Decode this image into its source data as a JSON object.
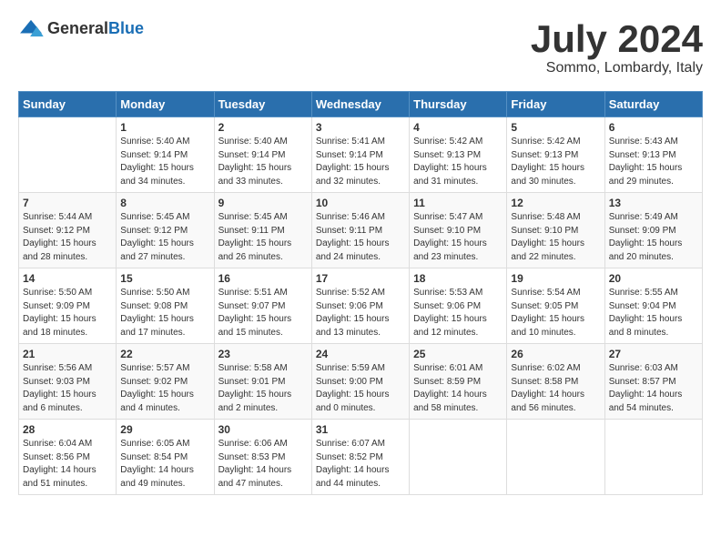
{
  "logo": {
    "general": "General",
    "blue": "Blue"
  },
  "title": "July 2024",
  "location": "Sommo, Lombardy, Italy",
  "weekdays": [
    "Sunday",
    "Monday",
    "Tuesday",
    "Wednesday",
    "Thursday",
    "Friday",
    "Saturday"
  ],
  "weeks": [
    [
      {
        "day": "",
        "info": ""
      },
      {
        "day": "1",
        "info": "Sunrise: 5:40 AM\nSunset: 9:14 PM\nDaylight: 15 hours\nand 34 minutes."
      },
      {
        "day": "2",
        "info": "Sunrise: 5:40 AM\nSunset: 9:14 PM\nDaylight: 15 hours\nand 33 minutes."
      },
      {
        "day": "3",
        "info": "Sunrise: 5:41 AM\nSunset: 9:14 PM\nDaylight: 15 hours\nand 32 minutes."
      },
      {
        "day": "4",
        "info": "Sunrise: 5:42 AM\nSunset: 9:13 PM\nDaylight: 15 hours\nand 31 minutes."
      },
      {
        "day": "5",
        "info": "Sunrise: 5:42 AM\nSunset: 9:13 PM\nDaylight: 15 hours\nand 30 minutes."
      },
      {
        "day": "6",
        "info": "Sunrise: 5:43 AM\nSunset: 9:13 PM\nDaylight: 15 hours\nand 29 minutes."
      }
    ],
    [
      {
        "day": "7",
        "info": "Sunrise: 5:44 AM\nSunset: 9:12 PM\nDaylight: 15 hours\nand 28 minutes."
      },
      {
        "day": "8",
        "info": "Sunrise: 5:45 AM\nSunset: 9:12 PM\nDaylight: 15 hours\nand 27 minutes."
      },
      {
        "day": "9",
        "info": "Sunrise: 5:45 AM\nSunset: 9:11 PM\nDaylight: 15 hours\nand 26 minutes."
      },
      {
        "day": "10",
        "info": "Sunrise: 5:46 AM\nSunset: 9:11 PM\nDaylight: 15 hours\nand 24 minutes."
      },
      {
        "day": "11",
        "info": "Sunrise: 5:47 AM\nSunset: 9:10 PM\nDaylight: 15 hours\nand 23 minutes."
      },
      {
        "day": "12",
        "info": "Sunrise: 5:48 AM\nSunset: 9:10 PM\nDaylight: 15 hours\nand 22 minutes."
      },
      {
        "day": "13",
        "info": "Sunrise: 5:49 AM\nSunset: 9:09 PM\nDaylight: 15 hours\nand 20 minutes."
      }
    ],
    [
      {
        "day": "14",
        "info": "Sunrise: 5:50 AM\nSunset: 9:09 PM\nDaylight: 15 hours\nand 18 minutes."
      },
      {
        "day": "15",
        "info": "Sunrise: 5:50 AM\nSunset: 9:08 PM\nDaylight: 15 hours\nand 17 minutes."
      },
      {
        "day": "16",
        "info": "Sunrise: 5:51 AM\nSunset: 9:07 PM\nDaylight: 15 hours\nand 15 minutes."
      },
      {
        "day": "17",
        "info": "Sunrise: 5:52 AM\nSunset: 9:06 PM\nDaylight: 15 hours\nand 13 minutes."
      },
      {
        "day": "18",
        "info": "Sunrise: 5:53 AM\nSunset: 9:06 PM\nDaylight: 15 hours\nand 12 minutes."
      },
      {
        "day": "19",
        "info": "Sunrise: 5:54 AM\nSunset: 9:05 PM\nDaylight: 15 hours\nand 10 minutes."
      },
      {
        "day": "20",
        "info": "Sunrise: 5:55 AM\nSunset: 9:04 PM\nDaylight: 15 hours\nand 8 minutes."
      }
    ],
    [
      {
        "day": "21",
        "info": "Sunrise: 5:56 AM\nSunset: 9:03 PM\nDaylight: 15 hours\nand 6 minutes."
      },
      {
        "day": "22",
        "info": "Sunrise: 5:57 AM\nSunset: 9:02 PM\nDaylight: 15 hours\nand 4 minutes."
      },
      {
        "day": "23",
        "info": "Sunrise: 5:58 AM\nSunset: 9:01 PM\nDaylight: 15 hours\nand 2 minutes."
      },
      {
        "day": "24",
        "info": "Sunrise: 5:59 AM\nSunset: 9:00 PM\nDaylight: 15 hours\nand 0 minutes."
      },
      {
        "day": "25",
        "info": "Sunrise: 6:01 AM\nSunset: 8:59 PM\nDaylight: 14 hours\nand 58 minutes."
      },
      {
        "day": "26",
        "info": "Sunrise: 6:02 AM\nSunset: 8:58 PM\nDaylight: 14 hours\nand 56 minutes."
      },
      {
        "day": "27",
        "info": "Sunrise: 6:03 AM\nSunset: 8:57 PM\nDaylight: 14 hours\nand 54 minutes."
      }
    ],
    [
      {
        "day": "28",
        "info": "Sunrise: 6:04 AM\nSunset: 8:56 PM\nDaylight: 14 hours\nand 51 minutes."
      },
      {
        "day": "29",
        "info": "Sunrise: 6:05 AM\nSunset: 8:54 PM\nDaylight: 14 hours\nand 49 minutes."
      },
      {
        "day": "30",
        "info": "Sunrise: 6:06 AM\nSunset: 8:53 PM\nDaylight: 14 hours\nand 47 minutes."
      },
      {
        "day": "31",
        "info": "Sunrise: 6:07 AM\nSunset: 8:52 PM\nDaylight: 14 hours\nand 44 minutes."
      },
      {
        "day": "",
        "info": ""
      },
      {
        "day": "",
        "info": ""
      },
      {
        "day": "",
        "info": ""
      }
    ]
  ]
}
